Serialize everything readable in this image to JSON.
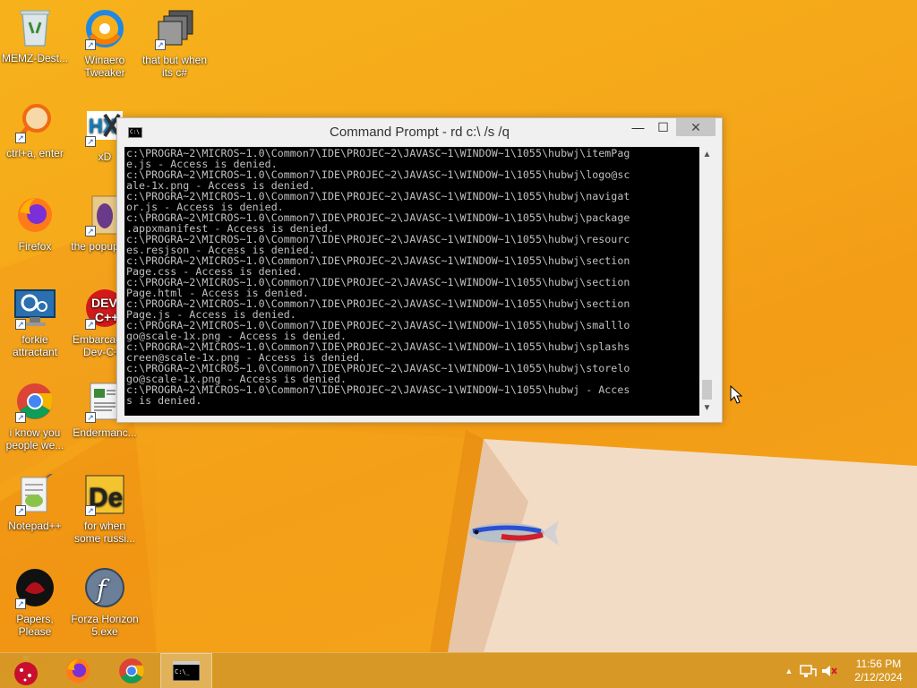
{
  "desktop": {
    "icons": [
      {
        "label": "MEMZ-Dest..."
      },
      {
        "label": "Winaero Tweaker"
      },
      {
        "label": "that but when its c#"
      },
      {
        "label": "ctrl+a, enter"
      },
      {
        "label": "xD"
      },
      {
        "label": "Firefox"
      },
      {
        "label": "the popup shit"
      },
      {
        "label": "forkie attractant"
      },
      {
        "label": "Embarcadero Dev-C++"
      },
      {
        "label": "i know you people we..."
      },
      {
        "label": "Endermanc..."
      },
      {
        "label": "Notepad++"
      },
      {
        "label": "for when some russi..."
      },
      {
        "label": "Papers, Please"
      },
      {
        "label": "Forza Horizon 5.exe"
      }
    ]
  },
  "window": {
    "title": "Command Prompt - rd  c:\\ /s /q",
    "minimize": "—",
    "maximize": "☐",
    "close": "✕",
    "console_lines": [
      "c:\\PROGRA~2\\MICROS~1.0\\Common7\\IDE\\PROJEC~2\\JAVASC~1\\WINDOW~1\\1055\\hubwj\\itemPag",
      "e.js - Access is denied.",
      "c:\\PROGRA~2\\MICROS~1.0\\Common7\\IDE\\PROJEC~2\\JAVASC~1\\WINDOW~1\\1055\\hubwj\\logo@sc",
      "ale-1x.png - Access is denied.",
      "c:\\PROGRA~2\\MICROS~1.0\\Common7\\IDE\\PROJEC~2\\JAVASC~1\\WINDOW~1\\1055\\hubwj\\navigat",
      "or.js - Access is denied.",
      "c:\\PROGRA~2\\MICROS~1.0\\Common7\\IDE\\PROJEC~2\\JAVASC~1\\WINDOW~1\\1055\\hubwj\\package",
      ".appxmanifest - Access is denied.",
      "c:\\PROGRA~2\\MICROS~1.0\\Common7\\IDE\\PROJEC~2\\JAVASC~1\\WINDOW~1\\1055\\hubwj\\resourc",
      "es.resjson - Access is denied.",
      "c:\\PROGRA~2\\MICROS~1.0\\Common7\\IDE\\PROJEC~2\\JAVASC~1\\WINDOW~1\\1055\\hubwj\\section",
      "Page.css - Access is denied.",
      "c:\\PROGRA~2\\MICROS~1.0\\Common7\\IDE\\PROJEC~2\\JAVASC~1\\WINDOW~1\\1055\\hubwj\\section",
      "Page.html - Access is denied.",
      "c:\\PROGRA~2\\MICROS~1.0\\Common7\\IDE\\PROJEC~2\\JAVASC~1\\WINDOW~1\\1055\\hubwj\\section",
      "Page.js - Access is denied.",
      "c:\\PROGRA~2\\MICROS~1.0\\Common7\\IDE\\PROJEC~2\\JAVASC~1\\WINDOW~1\\1055\\hubwj\\smalllo",
      "go@scale-1x.png - Access is denied.",
      "c:\\PROGRA~2\\MICROS~1.0\\Common7\\IDE\\PROJEC~2\\JAVASC~1\\WINDOW~1\\1055\\hubwj\\splashs",
      "creen@scale-1x.png - Access is denied.",
      "c:\\PROGRA~2\\MICROS~1.0\\Common7\\IDE\\PROJEC~2\\JAVASC~1\\WINDOW~1\\1055\\hubwj\\storelo",
      "go@scale-1x.png - Access is denied.",
      "c:\\PROGRA~2\\MICROS~1.0\\Common7\\IDE\\PROJEC~2\\JAVASC~1\\WINDOW~1\\1055\\hubwj - Acces",
      "s is denied."
    ]
  },
  "taskbar": {
    "apps": [
      {
        "icon": "memz-ornament-icon"
      },
      {
        "icon": "firefox-icon"
      },
      {
        "icon": "chrome-icon"
      },
      {
        "icon": "command-prompt-icon",
        "active": true
      }
    ],
    "tray_chevron": "▲",
    "clock_time": "11:56 PM",
    "clock_date": "2/12/2024"
  },
  "colors": {
    "wallpaper": "#f5a81a",
    "console_bg": "#000000",
    "console_fg": "#c0c0c0"
  }
}
